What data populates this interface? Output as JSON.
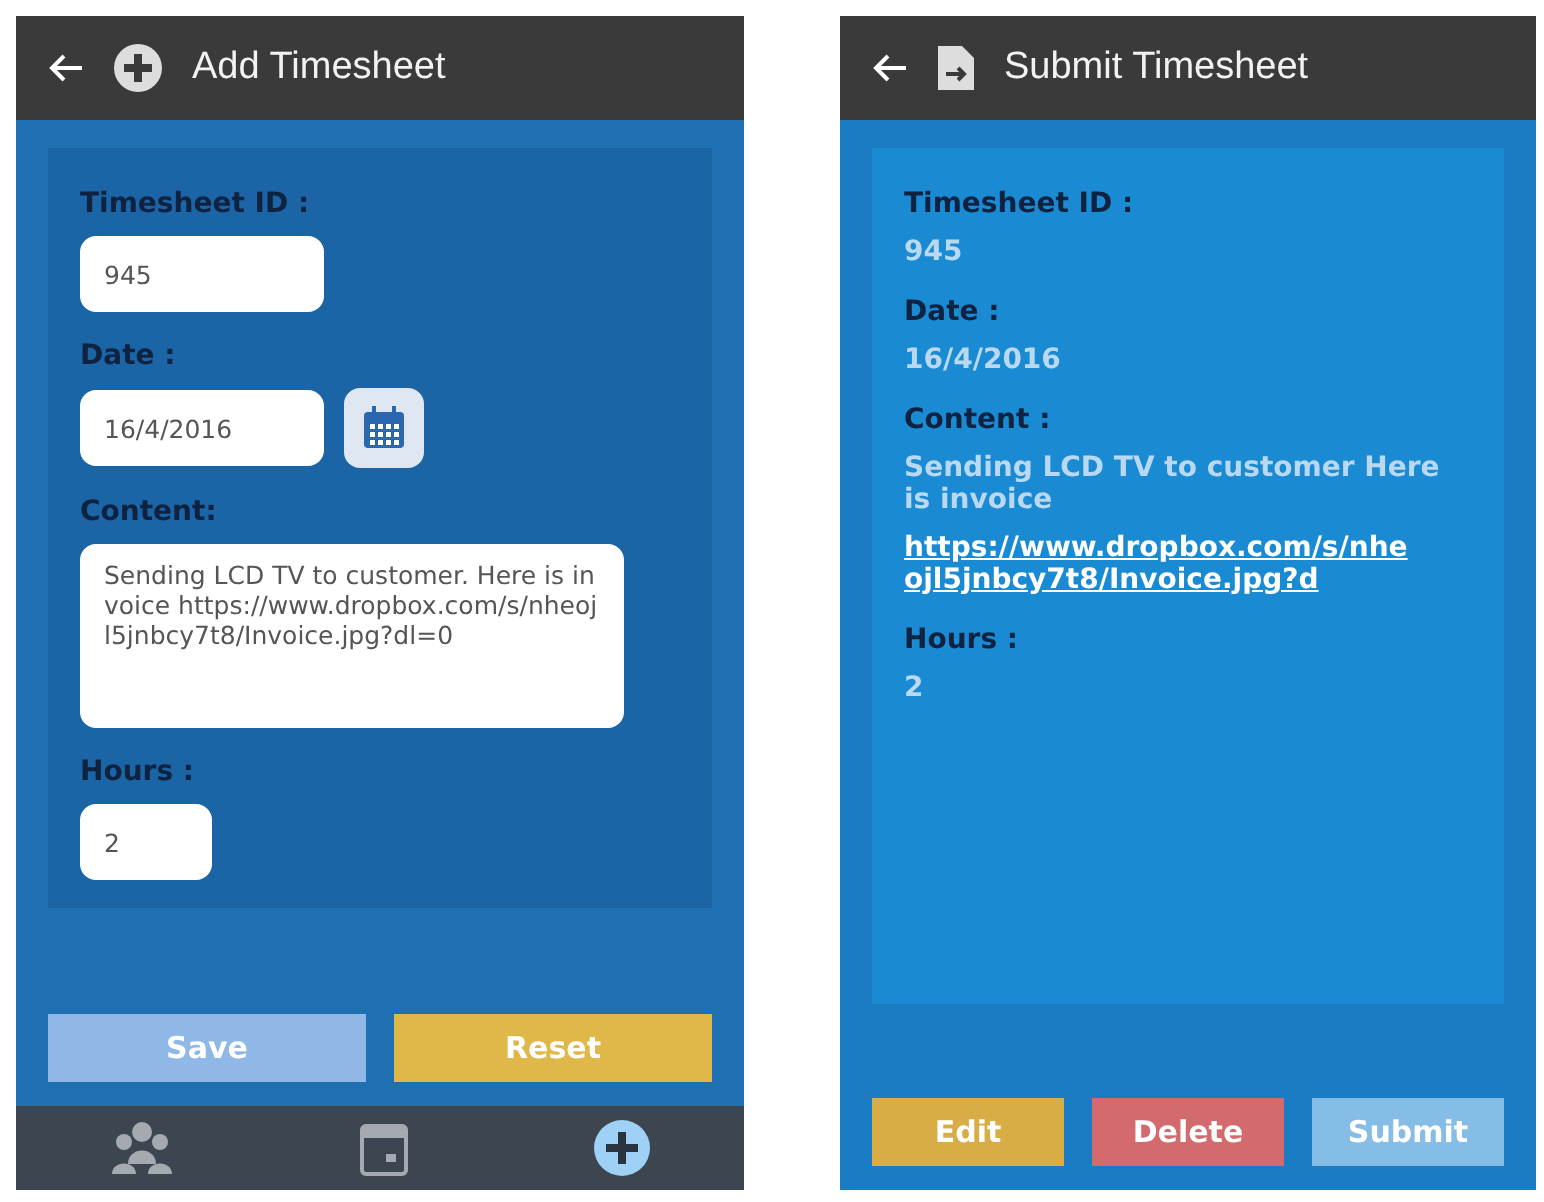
{
  "add_screen": {
    "title": "Add Timesheet",
    "fields": [
      {
        "kind": "text",
        "label": "Timesheet ID :",
        "value": "945"
      },
      {
        "kind": "date",
        "label": "Date :",
        "value": "16/4/2016"
      },
      {
        "kind": "multiline",
        "label": "Content:",
        "value": "Sending LCD TV to customer. Here is invoice  https://www.dropbox.com/s/nheojl5jnbcy7t8/Invoice.jpg?dl=0"
      },
      {
        "kind": "short",
        "label": "Hours :",
        "value": "2"
      }
    ],
    "buttons": [
      {
        "label": "Save",
        "color": "#8fb8e6"
      },
      {
        "label": "Reset",
        "color": "#e0b84a"
      }
    ],
    "nav": [
      {
        "kind": "people",
        "selected": false
      },
      {
        "kind": "calendar",
        "selected": false
      },
      {
        "kind": "add",
        "selected": true
      }
    ]
  },
  "submit_screen": {
    "title": "Submit Timesheet",
    "fields": [
      {
        "label": "Timesheet ID :",
        "value": "945"
      },
      {
        "label": "Date :",
        "value": "16/4/2016"
      },
      {
        "label": "Content :",
        "value": "Sending LCD TV to customer Here is invoice",
        "link": "https://www.dropbox.com/s/nheojl5jnbcy7t8/Invoice.jpg?d"
      },
      {
        "label": "Hours :",
        "value": "2"
      }
    ],
    "buttons": [
      {
        "label": "Edit",
        "color": "#d9ad45"
      },
      {
        "label": "Delete",
        "color": "#d26a6e"
      },
      {
        "label": "Submit",
        "color": "#86bde6"
      }
    ]
  }
}
